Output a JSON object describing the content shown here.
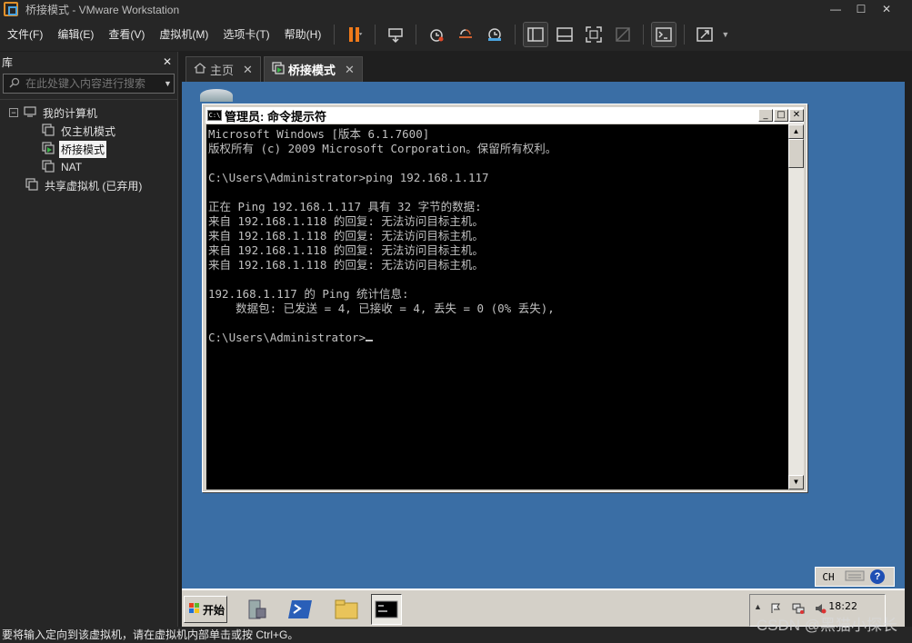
{
  "window": {
    "title": "桥接模式 - VMware Workstation",
    "controls": {
      "minimize": "—",
      "maximize": "☐",
      "close": "✕"
    }
  },
  "menu": [
    "文件(F)",
    "编辑(E)",
    "查看(V)",
    "虚拟机(M)",
    "选项卡(T)",
    "帮助(H)"
  ],
  "library": {
    "title": "库",
    "close": "✕",
    "search_placeholder": "在此处键入内容进行搜索",
    "root": {
      "label": "我的计算机",
      "toggle": "−"
    },
    "items": [
      {
        "label": "仅主机模式",
        "selected": false
      },
      {
        "label": "桥接模式",
        "selected": true
      },
      {
        "label": "NAT",
        "selected": false
      }
    ],
    "shared": "共享虚拟机 (已弃用)"
  },
  "tabs": [
    {
      "label": "主页",
      "close": "✕",
      "active": false
    },
    {
      "label": "桥接模式",
      "close": "✕",
      "active": true
    }
  ],
  "cmd": {
    "title": "管理员: 命令提示符",
    "icon_text": "C:\\",
    "lines": [
      "Microsoft Windows [版本 6.1.7600]",
      "版权所有 (c) 2009 Microsoft Corporation。保留所有权利。",
      "",
      "C:\\Users\\Administrator>ping 192.168.1.117",
      "",
      "正在 Ping 192.168.1.117 具有 32 字节的数据:",
      "来自 192.168.1.118 的回复: 无法访问目标主机。",
      "来自 192.168.1.118 的回复: 无法访问目标主机。",
      "来自 192.168.1.118 的回复: 无法访问目标主机。",
      "来自 192.168.1.118 的回复: 无法访问目标主机。",
      "",
      "192.168.1.117 的 Ping 统计信息:",
      "    数据包: 已发送 = 4, 已接收 = 4, 丢失 = 0 (0% 丢失),",
      ""
    ],
    "prompt": "C:\\Users\\Administrator>"
  },
  "langbar": {
    "lang": "CH"
  },
  "taskbar": {
    "start": "开始",
    "clock": "18:22"
  },
  "statusbar": {
    "text": "要将输入定向到该虚拟机，请在虚拟机内部单击或按 Ctrl+G。"
  },
  "watermark": "CSDN @黑猫小探长"
}
